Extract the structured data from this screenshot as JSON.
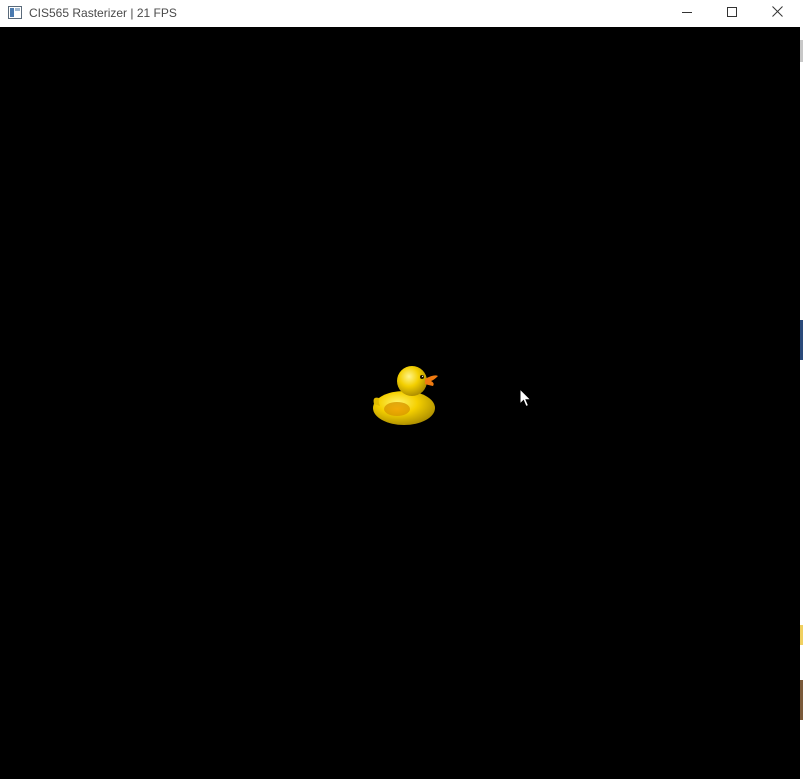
{
  "window": {
    "title": "CIS565 Rasterizer | 21 FPS"
  },
  "titlebar": {
    "icons": {
      "app": "app-window-icon",
      "minimize": "minimize-icon",
      "maximize": "maximize-icon",
      "close": "close-icon"
    }
  },
  "scene": {
    "object": "rubber-duck-model",
    "background_color": "#000000",
    "duck_color": "#f5d000",
    "beak_color": "#f07a10"
  }
}
